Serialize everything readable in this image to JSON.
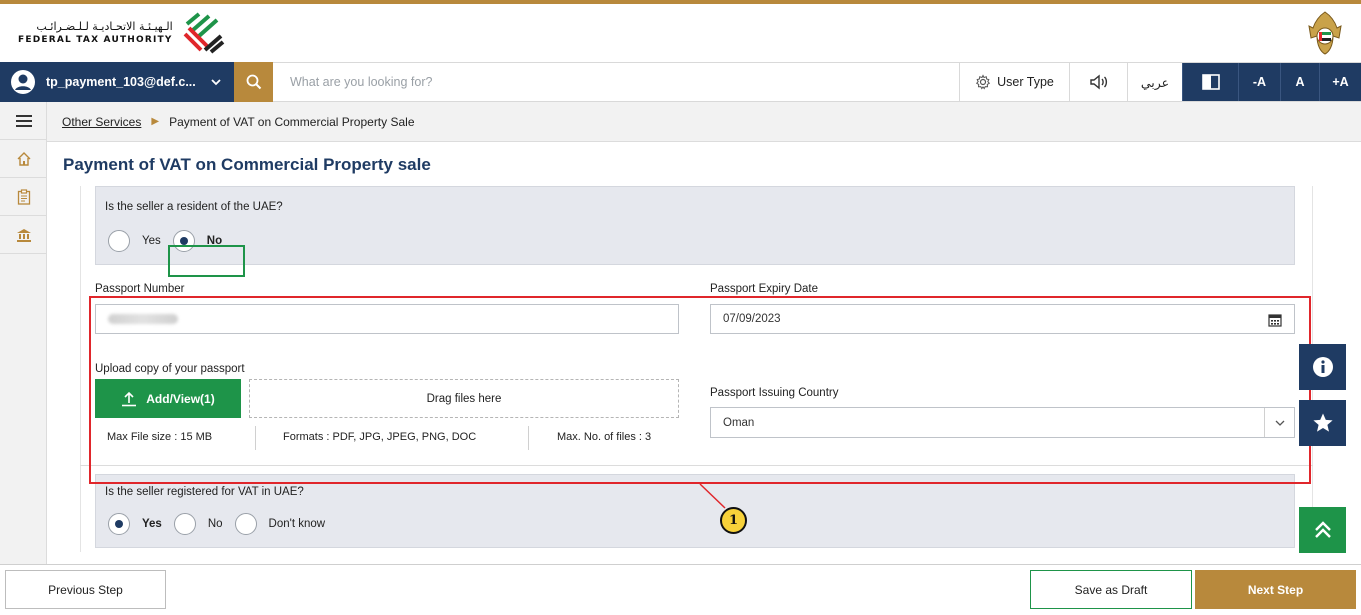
{
  "header": {
    "logo_arabic": "الـهيـئـة الاتحـاديـة لـلـضـرائـب",
    "logo_english": "FEDERAL TAX AUTHORITY"
  },
  "topbar": {
    "user_name": "tp_payment_103@def.c...",
    "search_placeholder": "What are you looking for?",
    "user_type_label": "User Type",
    "arabic_label": "عربي",
    "font_decrease": "-A",
    "font_normal": "A",
    "font_increase": "+A"
  },
  "breadcrumb": {
    "parent": "Other Services",
    "current": "Payment of VAT on Commercial Property Sale"
  },
  "page": {
    "title": "Payment of VAT on Commercial Property sale"
  },
  "form": {
    "resident_question": "Is the seller a resident of the UAE?",
    "resident_options": [
      "Yes",
      "No"
    ],
    "resident_selected": "No",
    "passport_number_label": "Passport Number",
    "passport_expiry_label": "Passport Expiry Date",
    "passport_expiry_value": "07/09/2023",
    "upload_label": "Upload copy of your passport",
    "add_view_label": "Add/View(1)",
    "drag_files_label": "Drag files here",
    "max_file_size": "Max File size : 15 MB",
    "formats": "Formats : PDF, JPG, JPEG, PNG, DOC",
    "max_files": "Max. No. of files : 3",
    "issuing_country_label": "Passport Issuing Country",
    "issuing_country_value": "Oman",
    "vat_question": "Is the seller registered for VAT in UAE?",
    "vat_options": [
      "Yes",
      "No",
      "Don't know"
    ],
    "vat_selected": "Yes"
  },
  "annotation": {
    "callout_number": "1"
  },
  "footer": {
    "previous_label": "Previous Step",
    "draft_label": "Save as Draft",
    "next_label": "Next Step"
  },
  "colors": {
    "navy": "#1f3b63",
    "gold": "#b8893c",
    "green": "#1e9449",
    "highlight_red": "#e0262b"
  }
}
